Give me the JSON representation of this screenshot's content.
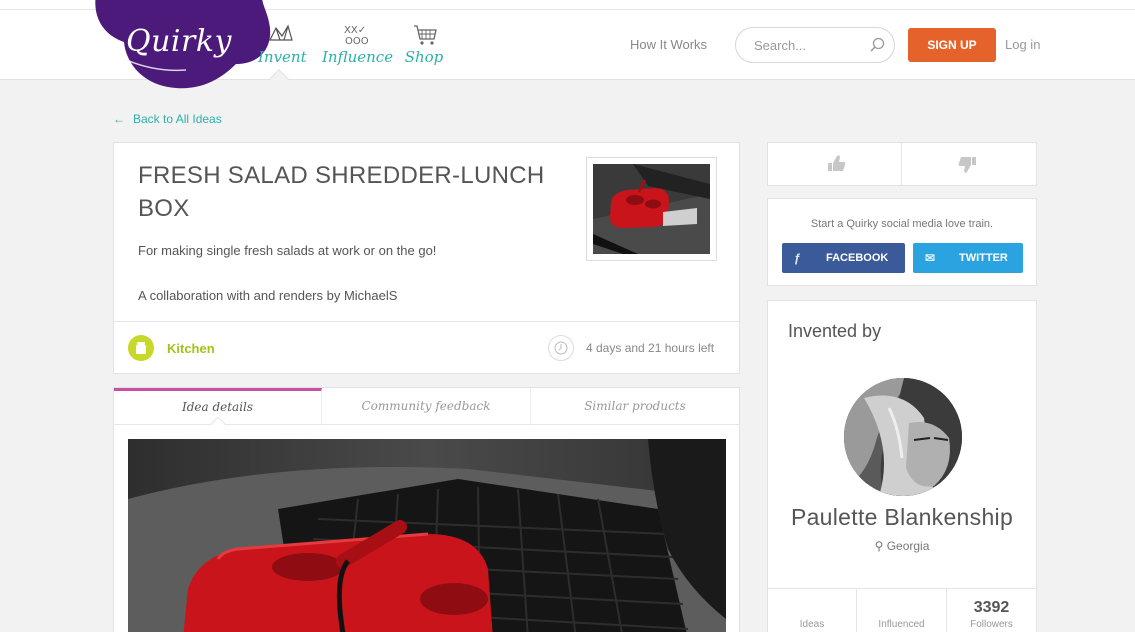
{
  "header": {
    "logo_text": "Quirky",
    "nav": [
      {
        "label": "Invent"
      },
      {
        "label": "Influence"
      },
      {
        "label": "Shop"
      }
    ],
    "how_it_works": "How It Works",
    "search_placeholder": "Search...",
    "signup": "SIGN UP",
    "login": "Log in"
  },
  "back_link": "Back to All Ideas",
  "idea": {
    "title": "FRESH SALAD SHREDDER-LUNCH BOX",
    "description": "For making single fresh salads at work or on the go!",
    "collaboration": "A collaboration with and renders by MichaelS",
    "category": "Kitchen",
    "time_left": "4 days and 21 hours left"
  },
  "tabs": [
    {
      "label": "Idea details",
      "active": true
    },
    {
      "label": "Community feedback",
      "active": false
    },
    {
      "label": "Similar products",
      "active": false
    }
  ],
  "social": {
    "prompt": "Start a Quirky social media love train.",
    "facebook": "FACEBOOK",
    "twitter": "TWITTER"
  },
  "inventor": {
    "heading": "Invented by",
    "name": "Paulette Blankenship",
    "location": "Georgia",
    "stats": [
      {
        "value": "",
        "label": "Ideas"
      },
      {
        "value": "",
        "label": "Influenced"
      },
      {
        "value": "3392",
        "label": "Followers"
      }
    ]
  },
  "colors": {
    "brand_purple": "#4b1a7a",
    "teal": "#2bb1a8",
    "signup_orange": "#e5632a",
    "kitchen_green": "#c7d82a",
    "facebook_blue": "#3b5a9a",
    "twitter_blue": "#2aa3e0",
    "active_tab_pink": "#c94fa3"
  },
  "icons": {
    "invent": "origami-bird-icon",
    "influence": "vote-marks-icon",
    "shop": "shopping-cart-icon",
    "search": "search-icon",
    "back": "left-arrow-icon",
    "category": "kitchen-icon",
    "time": "clock-icon",
    "vote_up": "thumbs-up-icon",
    "vote_down": "thumbs-down-icon",
    "facebook": "facebook-icon",
    "twitter": "twitter-icon",
    "location": "pin-icon"
  }
}
